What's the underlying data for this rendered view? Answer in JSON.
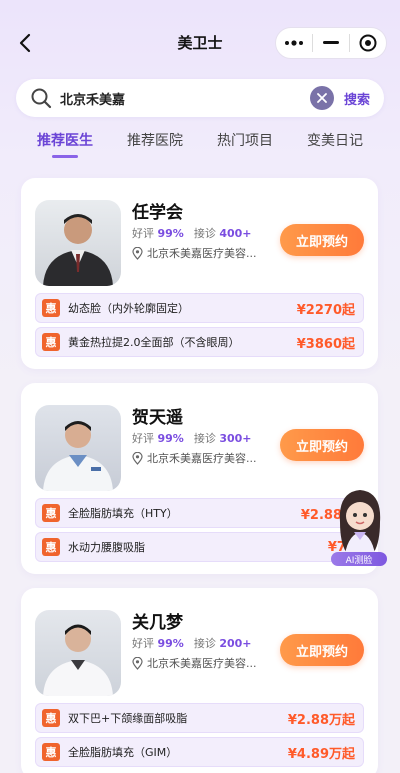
{
  "header": {
    "title": "美卫士",
    "back_icon": "chevron-left-icon",
    "capsule": [
      "more-dots-icon",
      "minimize-icon",
      "close-target-icon"
    ]
  },
  "search": {
    "value": "北京禾美嘉",
    "action_label": "搜索"
  },
  "tabs": [
    {
      "label": "推荐医生",
      "active": true
    },
    {
      "label": "推荐医院",
      "active": false
    },
    {
      "label": "热门项目",
      "active": false
    },
    {
      "label": "变美日记",
      "active": false
    }
  ],
  "doctors": [
    {
      "name": "任学会",
      "rating_label": "好评",
      "rating": "99%",
      "visits_label": "接诊",
      "visits": "400+",
      "location": "北京禾美嘉医疗美容...",
      "book_label": "立即预约",
      "items": [
        {
          "tag": "惠",
          "name": "幼态脸（内外轮廓固定）",
          "price": "¥2270起"
        },
        {
          "tag": "惠",
          "name": "黄金热拉提2.0全面部（不含眼周）",
          "price": "¥3860起"
        }
      ]
    },
    {
      "name": "贺天遥",
      "rating_label": "好评",
      "rating": "99%",
      "visits_label": "接诊",
      "visits": "300+",
      "location": "北京禾美嘉医疗美容...",
      "book_label": "立即预约",
      "items": [
        {
          "tag": "惠",
          "name": "全脸脂肪填充（HTY）",
          "price": "¥2.88万"
        },
        {
          "tag": "惠",
          "name": "水动力腰腹吸脂",
          "price": "¥78"
        }
      ]
    },
    {
      "name": "关几梦",
      "rating_label": "好评",
      "rating": "99%",
      "visits_label": "接诊",
      "visits": "200+",
      "location": "北京禾美嘉医疗美容...",
      "book_label": "立即预约",
      "items": [
        {
          "tag": "惠",
          "name": "双下巴+下颌缘面部吸脂",
          "price": "¥2.88万起"
        },
        {
          "tag": "惠",
          "name": "全脸脂肪填充（GIM）",
          "price": "¥4.89万起"
        }
      ]
    }
  ],
  "ai_assistant": {
    "label": "AI测脸"
  },
  "colors": {
    "accent": "#6b45d6",
    "button": "#ff7a3a",
    "price": "#ff5a2a"
  }
}
